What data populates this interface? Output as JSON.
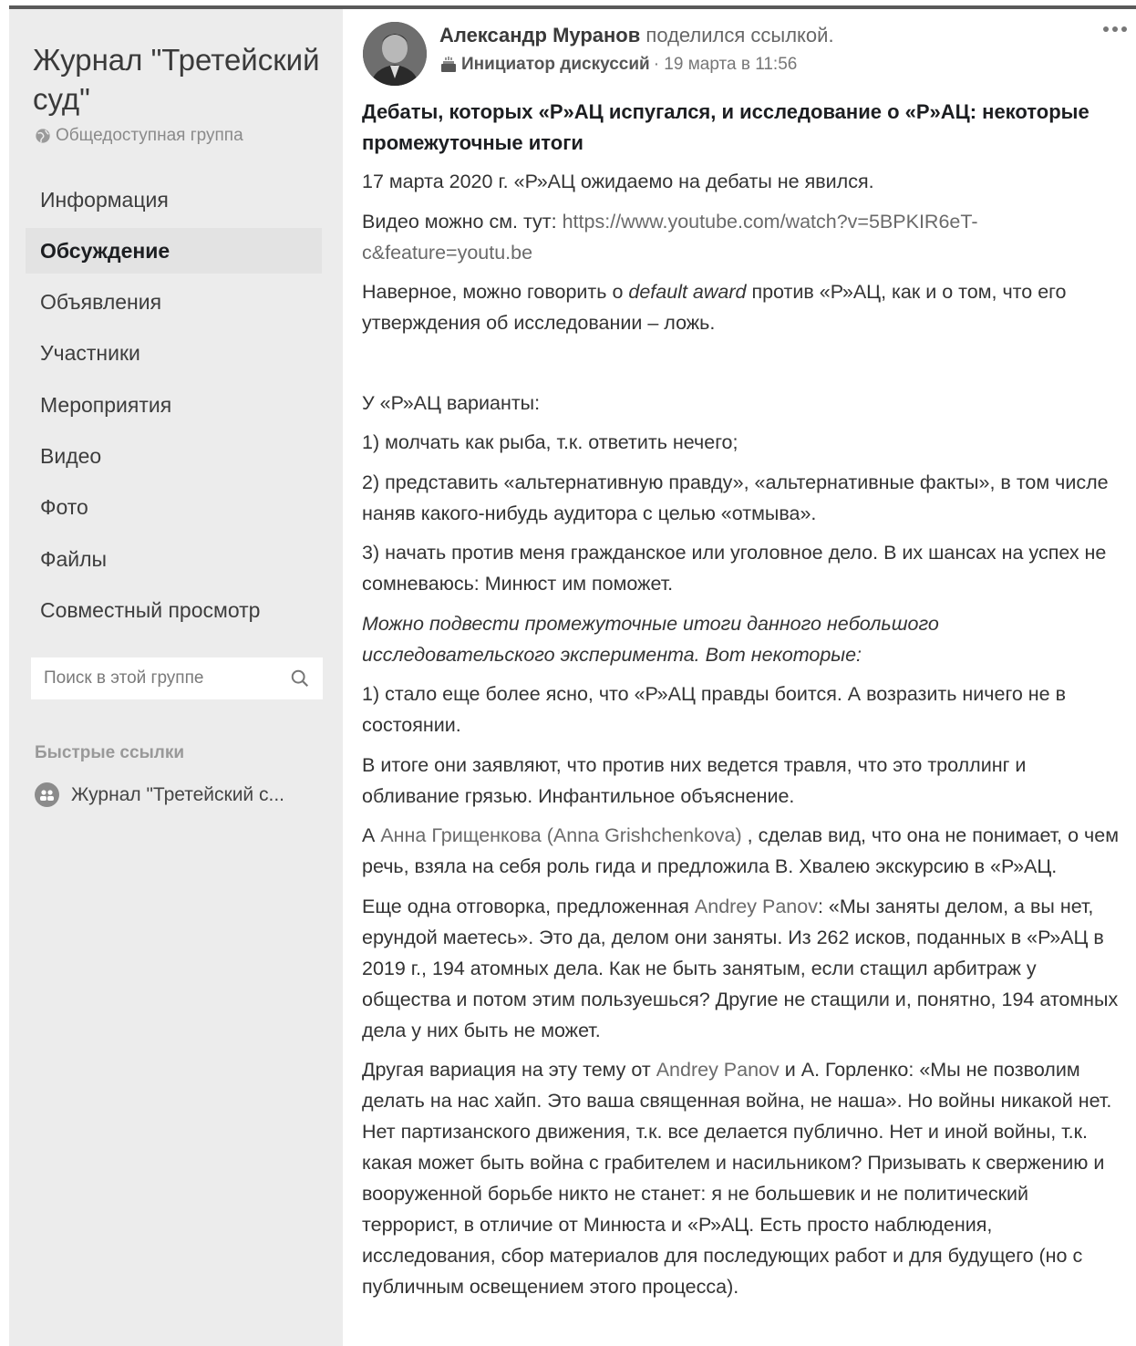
{
  "sidebar": {
    "group_title": "Журнал \"Третейский суд\"",
    "privacy": "Общедоступная группа",
    "nav": [
      {
        "label": "Информация",
        "active": false
      },
      {
        "label": "Обсуждение",
        "active": true
      },
      {
        "label": "Объявления",
        "active": false
      },
      {
        "label": "Участники",
        "active": false
      },
      {
        "label": "Мероприятия",
        "active": false
      },
      {
        "label": "Видео",
        "active": false
      },
      {
        "label": "Фото",
        "active": false
      },
      {
        "label": "Файлы",
        "active": false
      },
      {
        "label": "Совместный просмотр",
        "active": false
      }
    ],
    "search": {
      "placeholder": "Поиск в этой группе"
    },
    "quick_links_title": "Быстрые ссылки",
    "quick_link": "Журнал \"Третейский с..."
  },
  "post": {
    "author": "Александр Муранов",
    "action": "поделился ссылкой.",
    "badge": "Инициатор дискуссий",
    "time": "· 19 марта в 11:56",
    "title": "Дебаты, которых «Р»АЦ испугался, и исследование о «Р»АЦ: некоторые промежуточные итоги",
    "p1": "17 марта 2020 г. «Р»АЦ ожидаемо на дебаты не явился.",
    "p2_prefix": "Видео можно см. тут: ",
    "p2_link": "https://www.youtube.com/watch?v=5BPKIR6eT-c&feature=youtu.be",
    "p3_a": "Наверное, можно говорить о ",
    "p3_it": "default award",
    "p3_b": " против «Р»АЦ, как и о том, что его утверждения об исследовании – ложь.",
    "p4": "У «Р»АЦ варианты:",
    "p5": "1) молчать как рыба, т.к. ответить нечего;",
    "p6": "2) представить «альтернативную правду», «альтернативные факты», в том числе наняв какого-нибудь аудитора с целью «отмыва».",
    "p7": "3) начать против меня гражданское или уголовное дело. В их шансах на успех не сомневаюсь: Минюст им поможет.",
    "p8": "Можно подвести промежуточные итоги данного небольшого исследовательского эксперимента. Вот некоторые:",
    "p9": "1) стало еще более ясно, что «Р»АЦ правды боится. А возразить ничего не в состоянии.",
    "p10": "В итоге они заявляют, что против них ведется травля, что это троллинг и обливание грязью. Инфантильное объяснение.",
    "p11_a": "А ",
    "p11_mention": "Анна Грищенкова (Anna Grishchenkova)",
    "p11_b": " , сделав вид, что она не понимает, о чем речь, взяла на себя роль гида и предложила В. Хвалею экскурсию в «Р»АЦ.",
    "p12_a": "Еще одна отговорка, предложенная ",
    "p12_mention": "Andrey Panov",
    "p12_b": ": «Мы заняты делом, а вы нет, ерундой маетесь». Это да, делом они заняты. Из 262 исков, поданных в «Р»АЦ в 2019  г., 194 атомных дела. Как не быть занятым, если стащил арбитраж у общества и потом этим пользуешься? Другие не стащили и, понятно, 194 атомных дела у них быть не может.",
    "p13_a": "Другая вариация на эту тему от ",
    "p13_mention": "Andrey Panov",
    "p13_b": " и А. Горленко: «Мы не позволим делать на нас хайп. Это ваша священная война, не наша». Но войны никакой нет. Нет партизанского движения, т.к. все делается публично. Нет и иной войны, т.к. какая может быть война с грабителем и насильником? Призывать к свержению и вооруженной борьбе никто не станет: я не большевик и не политический террорист, в отличие от Минюста и «Р»АЦ. Есть просто наблюдения, исследования, сбор материалов для последующих работ и для будущего (но с публичным освещением этого процесса)."
  }
}
